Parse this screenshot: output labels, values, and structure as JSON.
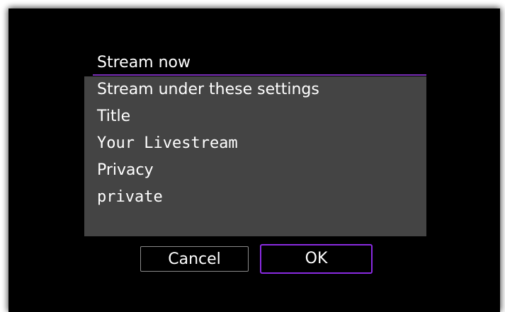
{
  "dialog": {
    "title": "Stream now",
    "lines": [
      "Stream under these settings",
      "Title",
      "Your Livestream",
      "Privacy",
      "private"
    ]
  },
  "buttons": {
    "cancel_label": "Cancel",
    "ok_label": "OK"
  },
  "colors": {
    "background": "#000000",
    "panel": "#444444",
    "accent": "#8a2be2",
    "text": "#ffffff"
  }
}
